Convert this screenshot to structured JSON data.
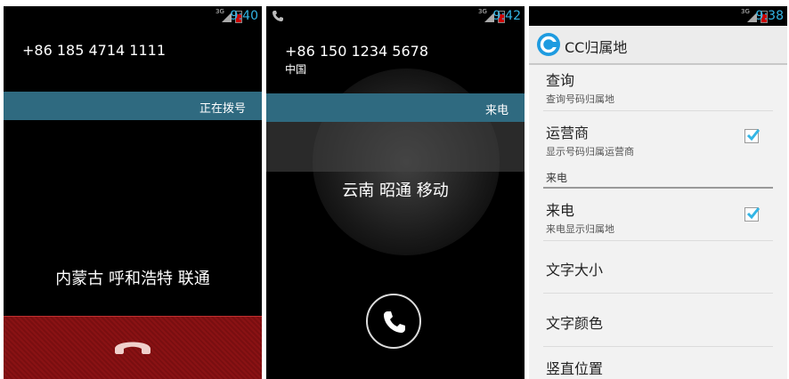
{
  "phone1": {
    "time": "9:40",
    "network": "3G",
    "phone_number": "+86 185 4714 1111",
    "status_label": "正在拨号",
    "location": "内蒙古 呼和浩特 联通"
  },
  "phone2": {
    "time": "9:42",
    "network": "3G",
    "phone_number": "+86 150 1234 5678",
    "country": "中国",
    "status_label": "来电",
    "location": "云南 昭通 移动"
  },
  "phone3": {
    "time": "9:38",
    "network": "3G",
    "app_title": "CC归属地",
    "prefs": [
      {
        "title": "查询",
        "summary": "查询号码归属地"
      },
      {
        "title": "运营商",
        "summary": "显示号码归属运营商",
        "checked": true
      },
      {
        "title": "来电",
        "summary": "来电显示归属地",
        "checked": true
      },
      {
        "title": "文字大小"
      },
      {
        "title": "文字颜色"
      },
      {
        "title": "竖直位置"
      }
    ],
    "category": "来电"
  },
  "colors": {
    "accent": "#33b5e5",
    "call_bar": "#2f6a80",
    "end_call": "#8a1214"
  },
  "icons": {
    "hangup": "hangup-icon",
    "answer": "phone-icon",
    "check": "checkmark-icon",
    "app": "app-logo-icon"
  }
}
